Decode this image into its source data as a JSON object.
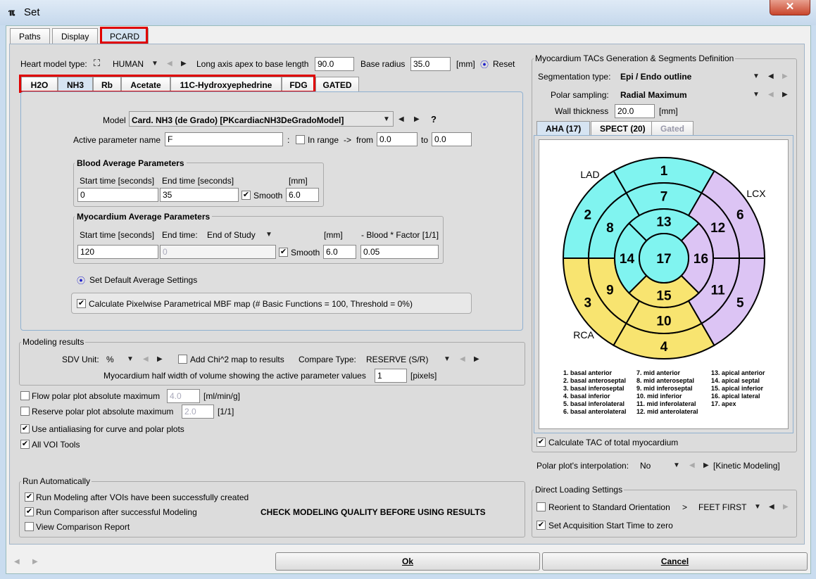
{
  "window": {
    "title": "Set",
    "close": "✕"
  },
  "tabs": [
    "Paths",
    "Display",
    "PCARD"
  ],
  "top": {
    "heart_model_label": "Heart model type:",
    "heart_model_value": "HUMAN",
    "long_axis_label": "Long axis apex to base length",
    "long_axis_value": "90.0",
    "base_radius_label": "Base radius",
    "base_radius_value": "35.0",
    "unit_mm": "[mm]",
    "reset": "Reset"
  },
  "tracer_tabs": [
    "H2O",
    "NH3",
    "Rb",
    "Acetate",
    "11C-Hydroxyephedrine",
    "FDG",
    "GATED"
  ],
  "model": {
    "label": "Model",
    "value": "Card. NH3 (de Grado) [PKcardiacNH3DeGradoModel]",
    "help": "?",
    "active_param_label": "Active parameter name",
    "active_param_value": "F",
    "colon": ":",
    "in_range": "In range",
    "arrow": "->",
    "from": "from",
    "from_value": "0.0",
    "to": "to",
    "to_value": "0.0"
  },
  "blood": {
    "title": "Blood Average Parameters",
    "start_label": "Start time [seconds]",
    "end_label": "End time [seconds]",
    "mm": "[mm]",
    "start": "0",
    "end": "35",
    "smooth": "Smooth",
    "smooth_value": "6.0"
  },
  "myo": {
    "title": "Myocardium Average Parameters",
    "start_label": "Start time [seconds]",
    "end_label": "End time:",
    "end_select": "End of Study",
    "mm": "[mm]",
    "factor_label": "- Blood * Factor [1/1]",
    "start": "120",
    "end": "0",
    "smooth": "Smooth",
    "smooth_value": "6.0",
    "factor": "0.05"
  },
  "default_avg": "Set Default Average Settings",
  "pixelwise": "Calculate Pixelwise Parametrical MBF map (# Basic Functions = 100, Threshold = 0%)",
  "modeling": {
    "title": "Modeling results",
    "sdv_label": "SDV Unit:",
    "sdv_value": "%",
    "chi": "Add Chi^2 map to results",
    "compare_label": "Compare Type:",
    "compare_value": "RESERVE (S/R)",
    "halfwidth_label": "Myocardium half width of volume showing the active parameter values",
    "halfwidth_value": "1",
    "pixels": "[pixels]"
  },
  "options": [
    {
      "label": "Flow polar plot absolute maximum",
      "checked": false,
      "value": "4.0",
      "unit": "[ml/min/g]"
    },
    {
      "label": "Reserve polar plot absolute maximum",
      "checked": false,
      "value": "2.0",
      "unit": "[1/1]"
    },
    {
      "label": "Use antialiasing for curve and polar plots",
      "checked": true
    },
    {
      "label": "All VOI Tools",
      "checked": true
    }
  ],
  "run": {
    "title": "Run Automatically",
    "items": [
      {
        "label": "Run Modeling after VOIs have been successfully created",
        "checked": true
      },
      {
        "label": "Run Comparison after successful Modeling",
        "checked": true
      },
      {
        "label": "View Comparison Report",
        "checked": false
      }
    ],
    "warning": "CHECK MODELING QUALITY BEFORE USING RESULTS"
  },
  "tacs": {
    "title": "Myocardium TACs Generation & Segments Definition",
    "seg_label": "Segmentation type:",
    "seg_value": "Epi / Endo outline",
    "polar_label": "Polar sampling:",
    "polar_value": "Radial Maximum",
    "wall_label": "Wall thickness",
    "wall_value": "20.0",
    "mm": "[mm]",
    "tabs": [
      "AHA (17)",
      "SPECT (20)",
      "Gated"
    ],
    "total": "Calculate TAC of total myocardium",
    "interp_label": "Polar plot's interpolation:",
    "interp_value": "No",
    "kinetic": "[Kinetic Modeling]"
  },
  "bullseye": {
    "colors": {
      "LAD": "#80f4f0",
      "LCX": "#dcc4f4",
      "RCA": "#f8e470"
    },
    "territories": [
      "LAD",
      "LCX",
      "RCA"
    ],
    "segments": {
      "outer": [
        {
          "n": "1",
          "t": "LAD"
        },
        {
          "n": "2",
          "t": "LAD"
        },
        {
          "n": "3",
          "t": "RCA"
        },
        {
          "n": "4",
          "t": "RCA"
        },
        {
          "n": "5",
          "t": "LCX"
        },
        {
          "n": "6",
          "t": "LCX"
        }
      ],
      "mid": [
        {
          "n": "7",
          "t": "LAD"
        },
        {
          "n": "8",
          "t": "LAD"
        },
        {
          "n": "9",
          "t": "RCA"
        },
        {
          "n": "10",
          "t": "RCA"
        },
        {
          "n": "11",
          "t": "LCX"
        },
        {
          "n": "12",
          "t": "LCX"
        }
      ],
      "apical": [
        {
          "n": "13",
          "t": "LAD"
        },
        {
          "n": "14",
          "t": "LAD"
        },
        {
          "n": "15",
          "t": "RCA"
        },
        {
          "n": "16",
          "t": "LCX"
        }
      ],
      "apex": {
        "n": "17",
        "t": "LAD"
      }
    },
    "legend": [
      [
        "1. basal anterior",
        "2. basal anteroseptal",
        "3. basal inferoseptal",
        "4. basal inferior",
        "5. basal inferolateral",
        "6. basal anterolateral"
      ],
      [
        "7. mid anterior",
        "8. mid anteroseptal",
        "9. mid inferoseptal",
        "10. mid inferior",
        "11. mid inferolateral",
        "12. mid anterolateral"
      ],
      [
        "13. apical anterior",
        "14. apical septal",
        "15. apical inferior",
        "16. apical lateral",
        "17. apex"
      ]
    ]
  },
  "direct": {
    "title": "Direct Loading Settings",
    "reorient": "Reorient to Standard Orientation",
    "gt": ">",
    "orient_value": "FEET FIRST",
    "acq": "Set Acquisition Start Time to zero"
  },
  "footer": {
    "ok": "Ok",
    "cancel": "Cancel"
  }
}
